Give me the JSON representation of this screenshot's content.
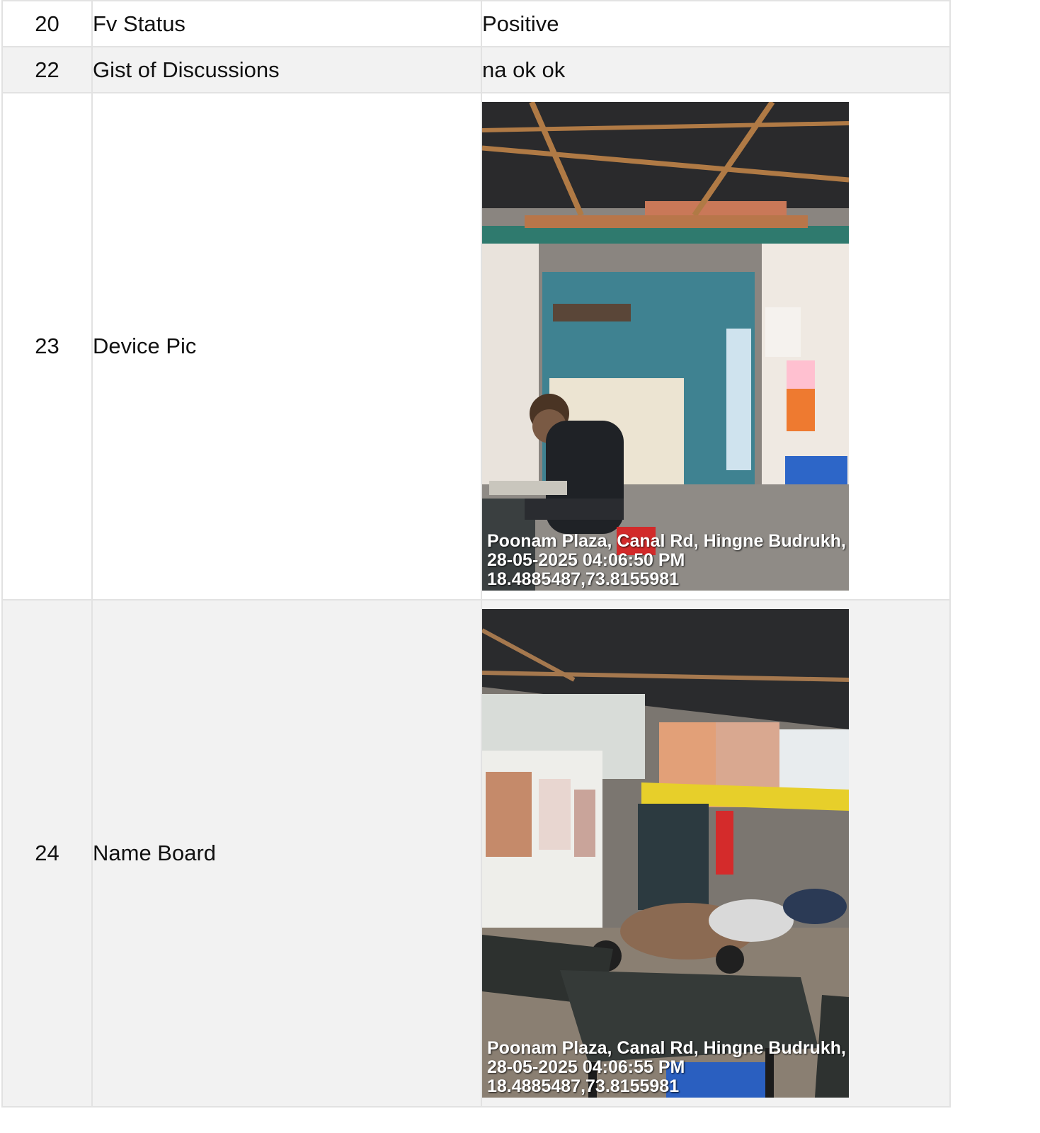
{
  "rows": [
    {
      "num": "20",
      "field": "Fv Status",
      "value": "Positive"
    },
    {
      "num": "22",
      "field": "Gist of Discussions",
      "value": "na ok ok"
    },
    {
      "num": "23",
      "field": "Device Pic",
      "photo": {
        "line1": "Poonam Plaza, Canal Rd, Hingne Budrukh, ...",
        "line2": "28-05-2025 04:06:50 PM",
        "line3": "18.4885487,73.8155981"
      }
    },
    {
      "num": "24",
      "field": "Name Board",
      "photo": {
        "line1": "Poonam Plaza, Canal Rd, Hingne Budrukh, ...",
        "line2": "28-05-2025 04:06:55 PM",
        "line3": "18.4885487,73.8155981"
      }
    }
  ],
  "colors": {
    "border": "#e2e2e2",
    "row_alt": "#f2f2f2"
  }
}
